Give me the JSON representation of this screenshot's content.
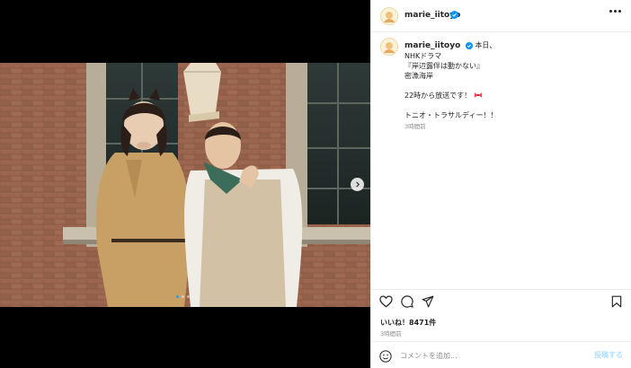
{
  "post": {
    "username": "marie_iitoyo",
    "verified": true,
    "caption_lines": [
      "本日、",
      "NHKドラマ",
      "『岸辺露伴は動かない』",
      "密漁海岸",
      "",
      "22時から放送です！",
      "",
      "トニオ・トラサルディー！！"
    ],
    "caption_time": "3時間前",
    "likes_text": "いいね！8471件",
    "post_time": "3時間前"
  },
  "media": {
    "carousel_count": 3,
    "active_index": 0
  },
  "icons": {
    "more": "more-options-icon",
    "like": "heart-icon",
    "comment": "comment-icon",
    "share": "paper-plane-icon",
    "save": "bookmark-icon",
    "emoji": "smiley-icon",
    "next": "chevron-right-icon",
    "verified": "verified-badge-icon",
    "bow": "ribbon-bow-emoji"
  },
  "comment": {
    "placeholder": "コメントを追加...",
    "post_label": "投稿する"
  },
  "colors": {
    "accent": "#3797f0",
    "verified": "#0095f6",
    "post_disabled": "#b2dffc",
    "bow": "#ed4956"
  }
}
